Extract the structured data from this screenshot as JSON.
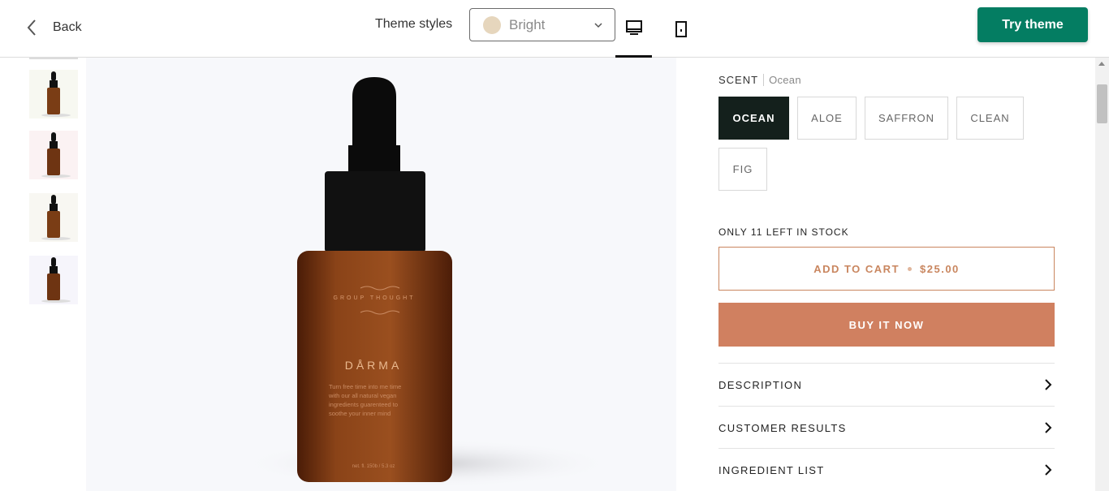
{
  "toolbar": {
    "back_label": "Back",
    "theme_styles_label": "Theme styles",
    "theme_selected": "Bright",
    "theme_swatch_color": "#e6d6bd",
    "try_theme_label": "Try theme",
    "try_theme_color": "#047d62"
  },
  "product": {
    "bottle_brand_top": "GROUP THOUGHT",
    "bottle_name": "DÅRMA",
    "bottle_text_1": "Turn free time into me time",
    "bottle_text_2": "with our all natural vegan",
    "bottle_text_3": "ingredients guarenteed to",
    "bottle_text_4": "soothe your inner mind",
    "bottle_volume": "net. fl. 150b / 5.3 oz"
  },
  "scent": {
    "label": "SCENT",
    "selected": "Ocean",
    "options": [
      "OCEAN",
      "ALOE",
      "SAFFRON",
      "CLEAN",
      "FIG"
    ]
  },
  "stock_text": "ONLY 11 LEFT IN STOCK",
  "add_to_cart": {
    "label": "ADD TO CART",
    "price": "$25.00",
    "color": "#c9865f"
  },
  "buy_now_label": "BUY IT NOW",
  "buy_now_color": "#d08060",
  "accordions": [
    "DESCRIPTION",
    "CUSTOMER RESULTS",
    "INGREDIENT LIST"
  ]
}
